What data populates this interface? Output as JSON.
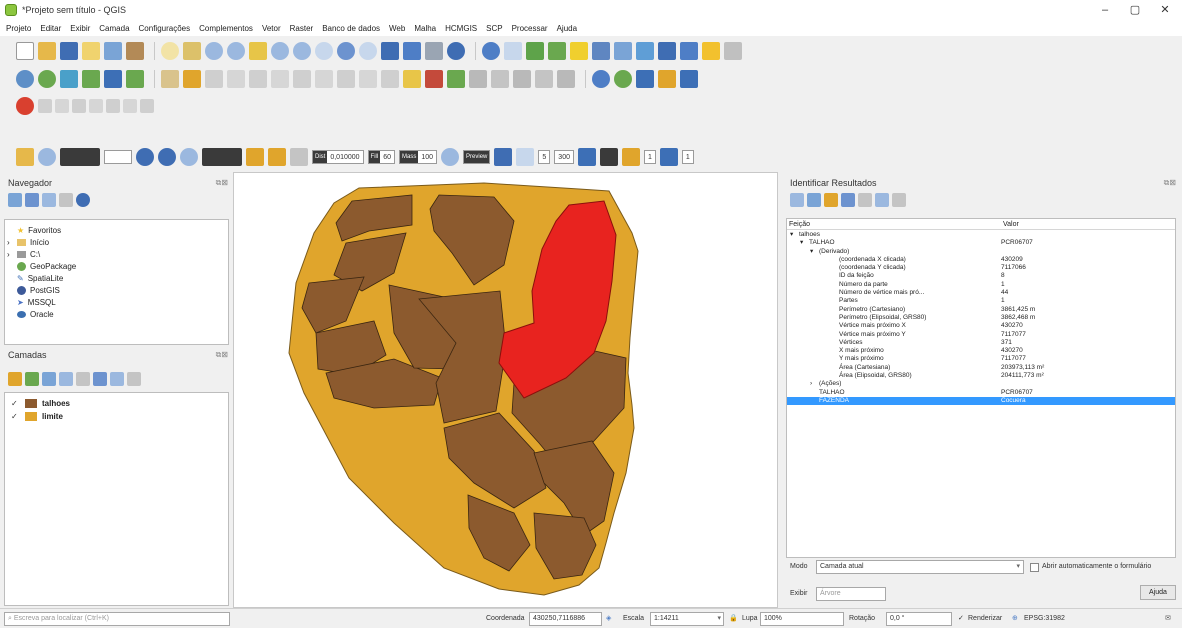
{
  "window": {
    "title": "*Projeto sem título - QGIS",
    "minimize": "–",
    "maximize": "▢",
    "close": "✕"
  },
  "menu": [
    "Projeto",
    "Editar",
    "Exibir",
    "Camada",
    "Configurações",
    "Complementos",
    "Vetor",
    "Raster",
    "Banco de dados",
    "Web",
    "Malha",
    "HCMGIS",
    "SCP",
    "Processar",
    "Ajuda"
  ],
  "toolbar4": {
    "dist_label": "Dist",
    "dist_value": "0,010000",
    "spin2_label": "Fill",
    "spin2_value": "60",
    "spin3_label": "Mass",
    "spin3_value": "100",
    "spin4_value": "5",
    "spin5_value": "300",
    "spin6_value": "1",
    "spin7_value": "1",
    "preview_label": "Preview"
  },
  "browser": {
    "title": "Navegador",
    "items": [
      {
        "expander": "",
        "label": "Favoritos",
        "icon": "star-icon",
        "color": "#f2c12e"
      },
      {
        "expander": "›",
        "label": "Início",
        "icon": "folder-icon",
        "color": "#e8c36a"
      },
      {
        "expander": "›",
        "label": "C:\\",
        "icon": "drive-icon",
        "color": "#9a9a9a"
      },
      {
        "expander": "",
        "label": "GeoPackage",
        "icon": "geopackage-icon",
        "color": "#6aa84f"
      },
      {
        "expander": "",
        "label": "SpatiaLite",
        "icon": "spatialite-icon",
        "color": "#3d6fb6"
      },
      {
        "expander": "",
        "label": "PostGIS",
        "icon": "postgis-icon",
        "color": "#3d5a99"
      },
      {
        "expander": "",
        "label": "MSSQL",
        "icon": "mssql-icon",
        "color": "#4a72c4"
      },
      {
        "expander": "",
        "label": "Oracle",
        "icon": "oracle-icon",
        "color": "#3b6fb0"
      }
    ]
  },
  "layers": {
    "title": "Camadas",
    "items": [
      {
        "check": "✓",
        "label": "talhoes",
        "color": "#8c5a2e"
      },
      {
        "check": "✓",
        "label": "limite",
        "color": "#e0a52c"
      }
    ]
  },
  "results": {
    "title": "Identificar Resultados",
    "col_feature": "Feição",
    "col_value": "Valor",
    "rows": [
      {
        "indent": 0,
        "exp": "▾",
        "feature": "talhoes",
        "value": ""
      },
      {
        "indent": 1,
        "exp": "▾",
        "feature": "TALHAO",
        "value": "PCR06707"
      },
      {
        "indent": 2,
        "exp": "▾",
        "feature": "(Derivado)",
        "value": ""
      },
      {
        "indent": 4,
        "exp": "",
        "feature": "(coordenada X clicada)",
        "value": "430209"
      },
      {
        "indent": 4,
        "exp": "",
        "feature": "(coordenada Y clicada)",
        "value": "7117066"
      },
      {
        "indent": 4,
        "exp": "",
        "feature": "ID da feição",
        "value": "8"
      },
      {
        "indent": 4,
        "exp": "",
        "feature": "Número da parte",
        "value": "1"
      },
      {
        "indent": 4,
        "exp": "",
        "feature": "Número de vértice mais pró...",
        "value": "44"
      },
      {
        "indent": 4,
        "exp": "",
        "feature": "Partes",
        "value": "1"
      },
      {
        "indent": 4,
        "exp": "",
        "feature": "Perímetro (Cartesiano)",
        "value": "3861,425 m"
      },
      {
        "indent": 4,
        "exp": "",
        "feature": "Perímetro (Elipsoidal, GRS80)",
        "value": "3862,468 m"
      },
      {
        "indent": 4,
        "exp": "",
        "feature": "Vértice mais próximo X",
        "value": "430270"
      },
      {
        "indent": 4,
        "exp": "",
        "feature": "Vértice mais próximo Y",
        "value": "7117077"
      },
      {
        "indent": 4,
        "exp": "",
        "feature": "Vértices",
        "value": "371"
      },
      {
        "indent": 4,
        "exp": "",
        "feature": "X mais próximo",
        "value": "430270"
      },
      {
        "indent": 4,
        "exp": "",
        "feature": "Y mais próximo",
        "value": "7117077"
      },
      {
        "indent": 4,
        "exp": "",
        "feature": "Área (Cartesiana)",
        "value": "203973,113 m²"
      },
      {
        "indent": 4,
        "exp": "",
        "feature": "Área (Elipsoidal, GRS80)",
        "value": "204111,773 m²"
      },
      {
        "indent": 2,
        "exp": "›",
        "feature": "(Ações)",
        "value": ""
      },
      {
        "indent": 2,
        "exp": "",
        "feature": "TALHAO",
        "value": "PCR06707"
      },
      {
        "indent": 2,
        "exp": "",
        "feature": "FAZENDA",
        "value": "Cocuera",
        "selected": true
      }
    ],
    "mode_label": "Modo",
    "mode_value": "Camada atual",
    "view_label": "Exibir",
    "view_value": "Árvore",
    "auto_open_label": "Abrir automaticamente o formulário",
    "help_button": "Ajuda"
  },
  "status": {
    "search_placeholder": "Escreva para localizar (Ctrl+K)",
    "coord_label": "Coordenada",
    "coord_value": "430250,7116886",
    "scale_label": "Escala",
    "scale_value": "1:14211",
    "magnifier_label": "Lupa",
    "magnifier_value": "100%",
    "rotation_label": "Rotação",
    "rotation_value": "0,0 °",
    "render_label": "Renderizar",
    "crs_value": "EPSG:31982"
  },
  "colors": {
    "limite": "#e0a52c",
    "talhoes": "#8c5a2e",
    "selected": "#e8231f",
    "accent": "#3399ff"
  }
}
